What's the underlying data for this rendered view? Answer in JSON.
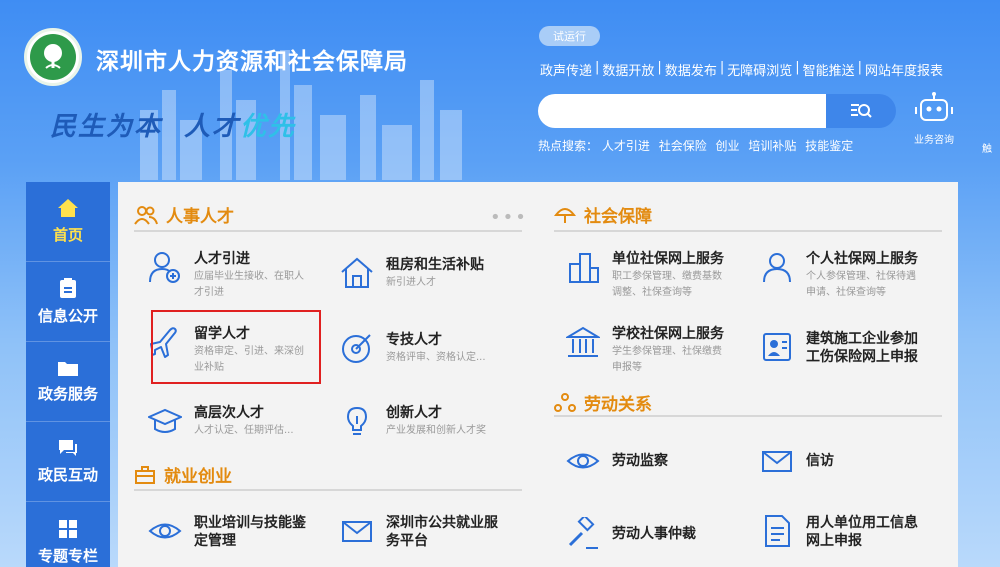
{
  "header": {
    "title": "深圳市人力资源和社会保障局",
    "slogan_1": "民生为本",
    "slogan_2a": "人才",
    "slogan_2b": "优先",
    "badge": "试运行",
    "top_links": [
      "政声传递",
      "数据开放",
      "数据发布",
      "无障碍浏览",
      "智能推送",
      "网站年度报表"
    ],
    "hot_label": "热点搜索：",
    "hot_words": [
      "人才引进",
      "社会保险",
      "创业",
      "培训补贴",
      "技能鉴定"
    ],
    "search": {
      "placeholder": ""
    },
    "robot_label": "业务咨询",
    "edge_label": "触"
  },
  "nav": {
    "items": [
      {
        "label": "首页",
        "icon": "home-icon",
        "active": true
      },
      {
        "label": "信息公开",
        "icon": "document-icon"
      },
      {
        "label": "政务服务",
        "icon": "folder-icon"
      },
      {
        "label": "政民互动",
        "icon": "chat-icon"
      },
      {
        "label": "专题专栏",
        "icon": "grid-icon"
      }
    ]
  },
  "sections": {
    "talent": {
      "title": "人事人才",
      "more": "•••"
    },
    "social": {
      "title": "社会保障"
    },
    "labor": {
      "title": "劳动关系"
    },
    "employment": {
      "title": "就业创业"
    }
  },
  "talent_items": [
    {
      "title": "人才引进",
      "desc_1": "应届毕业生接收、在职人",
      "desc_2": "才引进",
      "icon": "user-add-icon"
    },
    {
      "title": "租房和生活补贴",
      "desc_1": "新引进人才",
      "desc_2": "",
      "icon": "house-icon"
    },
    {
      "title": "留学人才",
      "desc_1": "资格审定、引进、来深创",
      "desc_2": "业补贴",
      "icon": "airplane-icon"
    },
    {
      "title": "专技人才",
      "desc_1": "资格评审、资格认定...",
      "desc_2": "",
      "icon": "target-icon"
    },
    {
      "title": "高层次人才",
      "desc_1": "人才认定、任期评估...",
      "desc_2": "",
      "icon": "graduation-cap-icon"
    },
    {
      "title": "创新人才",
      "desc_1": "产业发展和创新人才奖",
      "desc_2": "",
      "icon": "lightbulb-icon"
    }
  ],
  "employment_items": [
    {
      "title_1": "职业培训与技能鉴",
      "title_2": "定管理",
      "icon": "eye-icon"
    },
    {
      "title_1": "深圳市公共就业服",
      "title_2": "务平台",
      "icon": "mail-icon"
    }
  ],
  "social_items": [
    {
      "title": "单位社保网上服务",
      "desc_1": "职工参保管理、缴费基数",
      "desc_2": "调整、社保查询等",
      "icon": "building-icon"
    },
    {
      "title": "个人社保网上服务",
      "desc_1": "个人参保管理、社保待遇",
      "desc_2": "申请、社保查询等",
      "icon": "person-icon"
    },
    {
      "title": "学校社保网上服务",
      "desc_1": "学生参保管理、社保缴费",
      "desc_2": "申报等",
      "icon": "school-icon"
    },
    {
      "title_1": "建筑施工企业参加",
      "title_2": "工伤保险网上申报",
      "icon": "worker-card-icon"
    }
  ],
  "labor_items": [
    {
      "title": "劳动监察",
      "icon": "eye-icon"
    },
    {
      "title": "信访",
      "icon": "mail-icon"
    },
    {
      "title": "劳动人事仲裁",
      "icon": "gavel-icon"
    },
    {
      "title_1": "用人单位用工信息",
      "title_2": "网上申报",
      "icon": "document-icon"
    }
  ]
}
